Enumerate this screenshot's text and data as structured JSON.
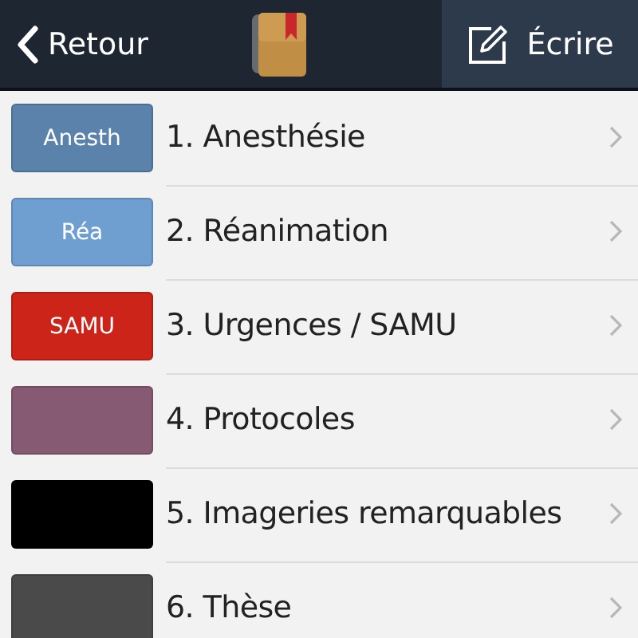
{
  "header": {
    "back": "Retour",
    "write": "Écrire"
  },
  "items": [
    {
      "tile": "Anesth",
      "color": "#5a82aa",
      "label": "1. Anesthésie"
    },
    {
      "tile": "Réa",
      "color": "#6f9fd0",
      "label": "2. Réanimation"
    },
    {
      "tile": "SAMU",
      "color": "#cc2418",
      "label": "3. Urgences / SAMU"
    },
    {
      "color": "#875a74",
      "label": "4. Protocoles"
    },
    {
      "color": "#000000",
      "label": "5. Imageries remarquables"
    },
    {
      "color": "#4a4a4a",
      "label": "6. Thèse"
    }
  ]
}
